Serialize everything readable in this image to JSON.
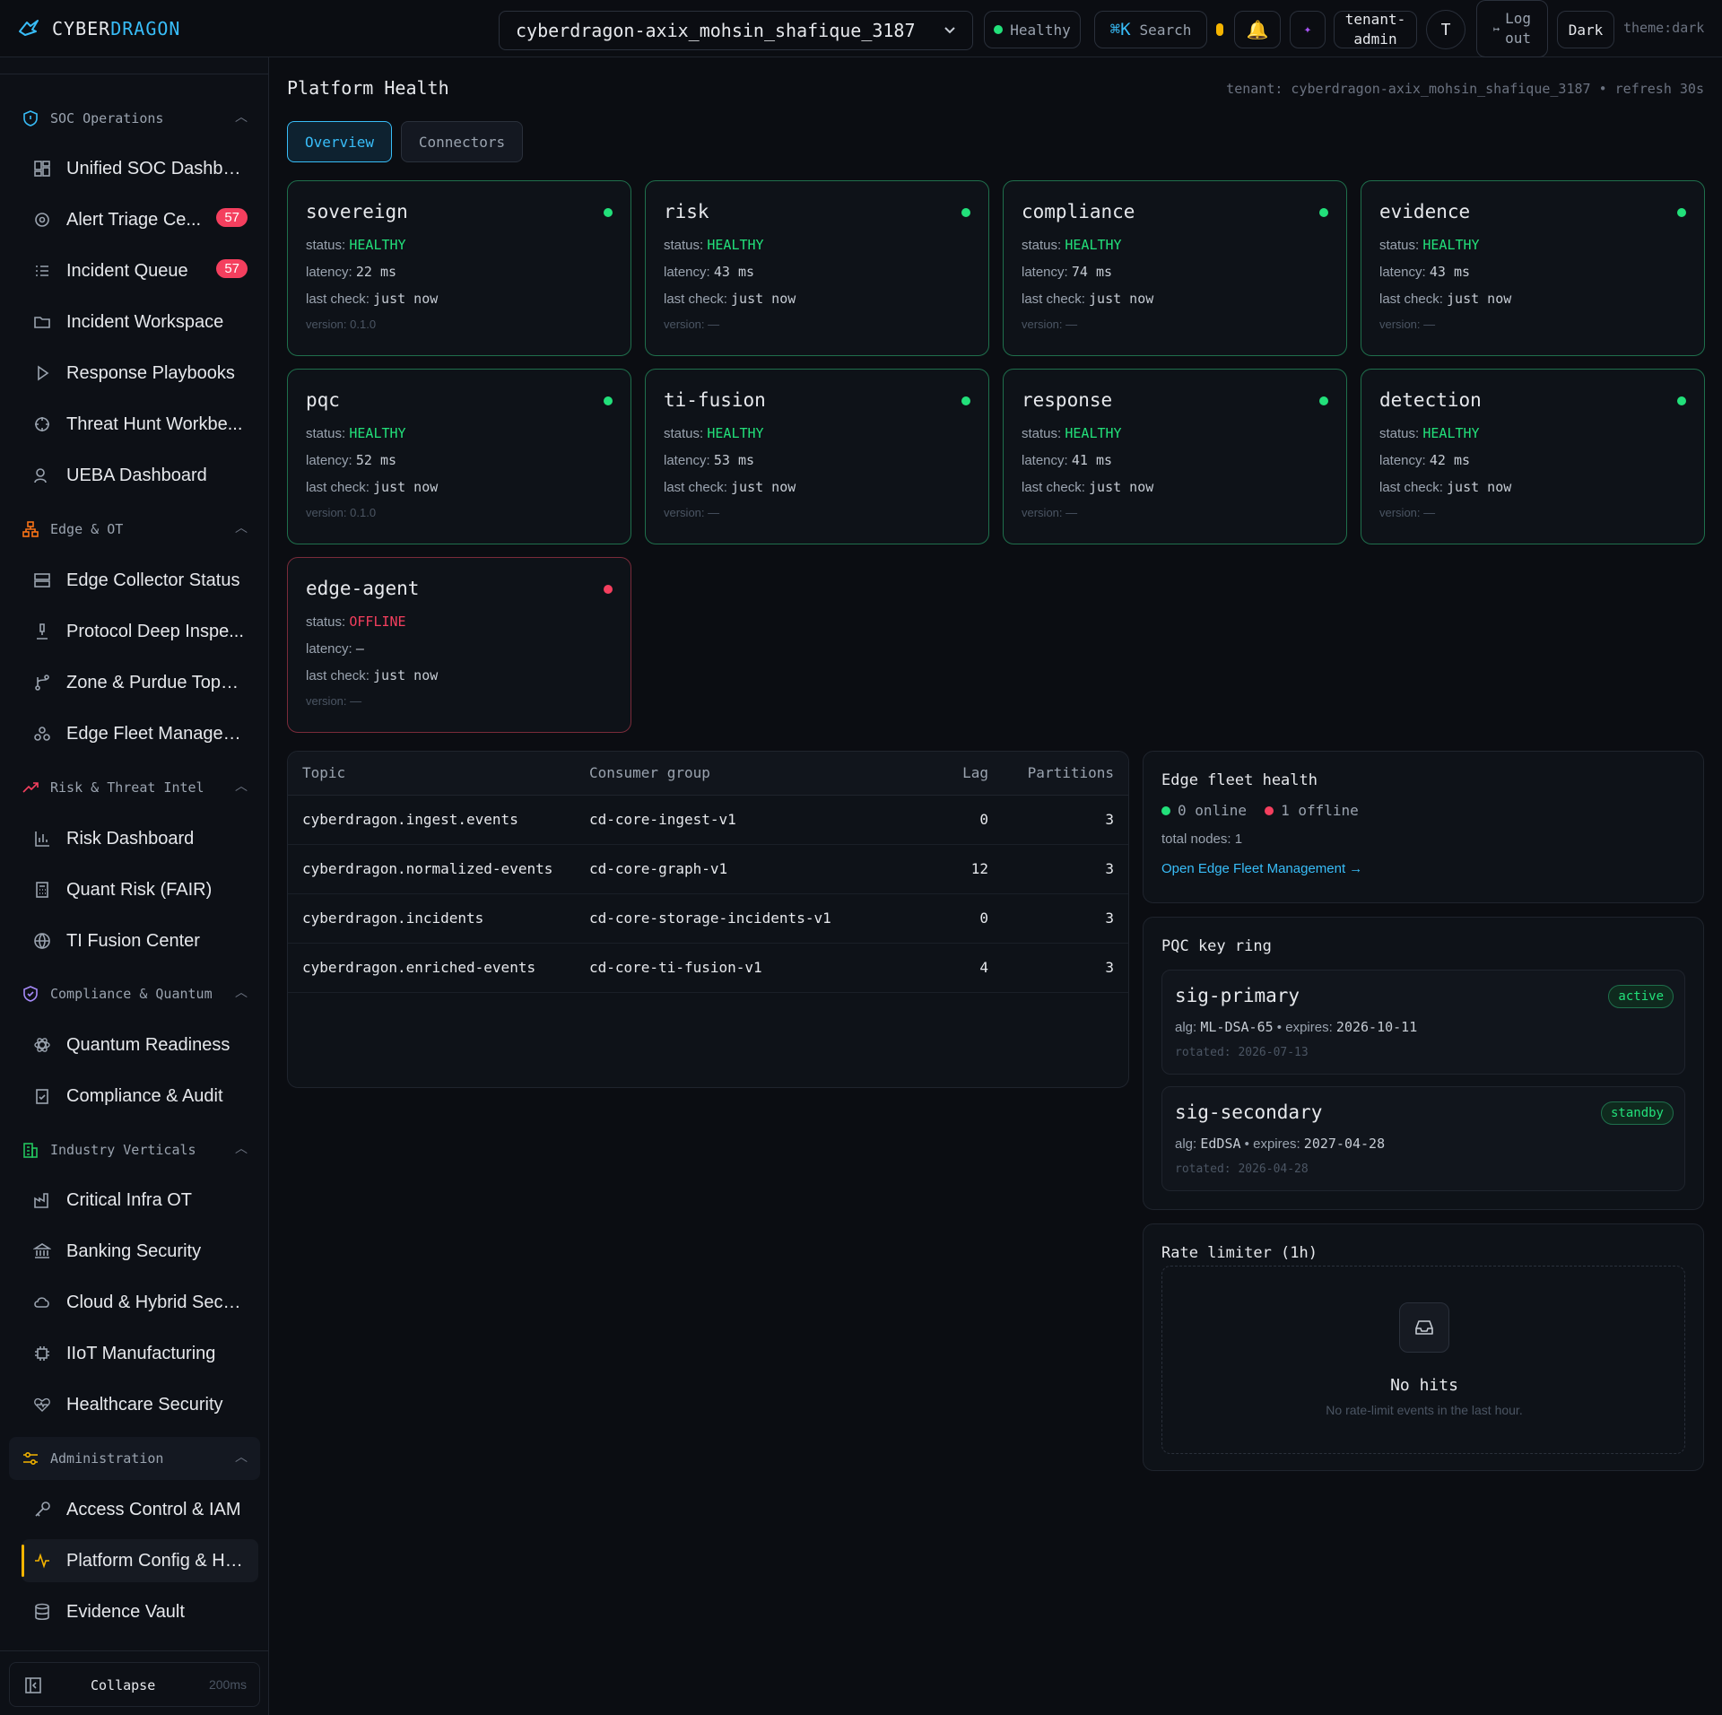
{
  "brand": {
    "part1": "CYBER",
    "part2": "DRAGON"
  },
  "topbar": {
    "tenant_select": "cyberdragon-axix_mohsin_shafique_3187",
    "health": "Healthy",
    "search_key": "⌘K",
    "search_label": "Search",
    "role_line1": "tenant-",
    "role_line2": "admin",
    "avatar": "T",
    "logout_line1": "Log",
    "logout_line2": "out",
    "theme_button": "Dark",
    "theme_label": "theme:dark"
  },
  "sidebar": {
    "groups": [
      {
        "label": "SOC Operations",
        "color": "#38bdf8"
      },
      {
        "label": "Edge & OT",
        "color": "#f97316"
      },
      {
        "label": "Risk & Threat Intel",
        "color": "#f43f5e"
      },
      {
        "label": "Compliance & Quantum",
        "color": "#a78bfa"
      },
      {
        "label": "Industry Verticals",
        "color": "#22c55e"
      },
      {
        "label": "Administration",
        "color": "#f5b400"
      }
    ],
    "items": [
      {
        "label": "Unified SOC Dashbo..."
      },
      {
        "label": "Alert Triage Ce...",
        "badge": "57"
      },
      {
        "label": "Incident Queue",
        "badge": "57"
      },
      {
        "label": "Incident Workspace"
      },
      {
        "label": "Response Playbooks"
      },
      {
        "label": "Threat Hunt Workbe..."
      },
      {
        "label": "UEBA Dashboard"
      },
      {
        "label": "Edge Collector Status"
      },
      {
        "label": "Protocol Deep Inspe..."
      },
      {
        "label": "Zone & Purdue Topol..."
      },
      {
        "label": "Edge Fleet Managem..."
      },
      {
        "label": "Risk Dashboard"
      },
      {
        "label": "Quant Risk (FAIR)"
      },
      {
        "label": "TI Fusion Center"
      },
      {
        "label": "Quantum Readiness"
      },
      {
        "label": "Compliance & Audit"
      },
      {
        "label": "Critical Infra OT"
      },
      {
        "label": "Banking Security"
      },
      {
        "label": "Cloud & Hybrid Secu..."
      },
      {
        "label": "IIoT Manufacturing"
      },
      {
        "label": "Healthcare Security"
      },
      {
        "label": "Access Control & IAM"
      },
      {
        "label": "Platform Config & He..."
      },
      {
        "label": "Evidence Vault"
      }
    ],
    "collapse": {
      "label": "Collapse",
      "hint": "200ms"
    }
  },
  "main": {
    "title": "Platform Health",
    "tenant_info": "tenant: cyberdragon-axix_mohsin_shafique_3187 • refresh 30s",
    "tabs": [
      "Overview",
      "Connectors"
    ],
    "labels": {
      "status": "status: ",
      "latency": "latency: ",
      "last_check": "last check: ",
      "version": "version: "
    },
    "services": [
      {
        "name": "sovereign",
        "status": "HEALTHY",
        "latency": "22 ms",
        "last_check": "just now",
        "version": "0.1.0"
      },
      {
        "name": "risk",
        "status": "HEALTHY",
        "latency": "43 ms",
        "last_check": "just now",
        "version": "—"
      },
      {
        "name": "compliance",
        "status": "HEALTHY",
        "latency": "74 ms",
        "last_check": "just now",
        "version": "—"
      },
      {
        "name": "evidence",
        "status": "HEALTHY",
        "latency": "43 ms",
        "last_check": "just now",
        "version": "—"
      },
      {
        "name": "pqc",
        "status": "HEALTHY",
        "latency": "52 ms",
        "last_check": "just now",
        "version": "0.1.0"
      },
      {
        "name": "ti-fusion",
        "status": "HEALTHY",
        "latency": "53 ms",
        "last_check": "just now",
        "version": "—"
      },
      {
        "name": "response",
        "status": "HEALTHY",
        "latency": "41 ms",
        "last_check": "just now",
        "version": "—"
      },
      {
        "name": "detection",
        "status": "HEALTHY",
        "latency": "42 ms",
        "last_check": "just now",
        "version": "—"
      },
      {
        "name": "edge-agent",
        "status": "OFFLINE",
        "latency": "—",
        "last_check": "just now",
        "version": "—"
      }
    ],
    "topics_table": {
      "headers": [
        "Topic",
        "Consumer group",
        "Lag",
        "Partitions"
      ],
      "rows": [
        [
          "cyberdragon.ingest.events",
          "cd-core-ingest-v1",
          "0",
          "3"
        ],
        [
          "cyberdragon.normalized-events",
          "cd-core-graph-v1",
          "12",
          "3"
        ],
        [
          "cyberdragon.incidents",
          "cd-core-storage-incidents-v1",
          "0",
          "3"
        ],
        [
          "cyberdragon.enriched-events",
          "cd-core-ti-fusion-v1",
          "4",
          "3"
        ]
      ]
    },
    "edge_fleet": {
      "title": "Edge fleet health",
      "online": "0 online",
      "offline": "1 offline",
      "total": "total nodes: 1",
      "link": "Open Edge Fleet Management →"
    },
    "pqc_ring": {
      "title": "PQC key ring",
      "keys": [
        {
          "name": "sig-primary",
          "badge": "active",
          "alg_label": "alg: ",
          "alg": "ML-DSA-65",
          "exp_label": " • expires: ",
          "expires": "2026-10-11",
          "rotated": "rotated: 2026-07-13"
        },
        {
          "name": "sig-secondary",
          "badge": "standby",
          "alg_label": "alg: ",
          "alg": "EdDSA",
          "exp_label": " • expires: ",
          "expires": "2027-04-28",
          "rotated": "rotated: 2026-04-28"
        }
      ]
    },
    "rate_limiter": {
      "title": "Rate limiter (1h)",
      "empty_title": "No hits",
      "empty_text": "No rate-limit events in the last hour."
    }
  }
}
